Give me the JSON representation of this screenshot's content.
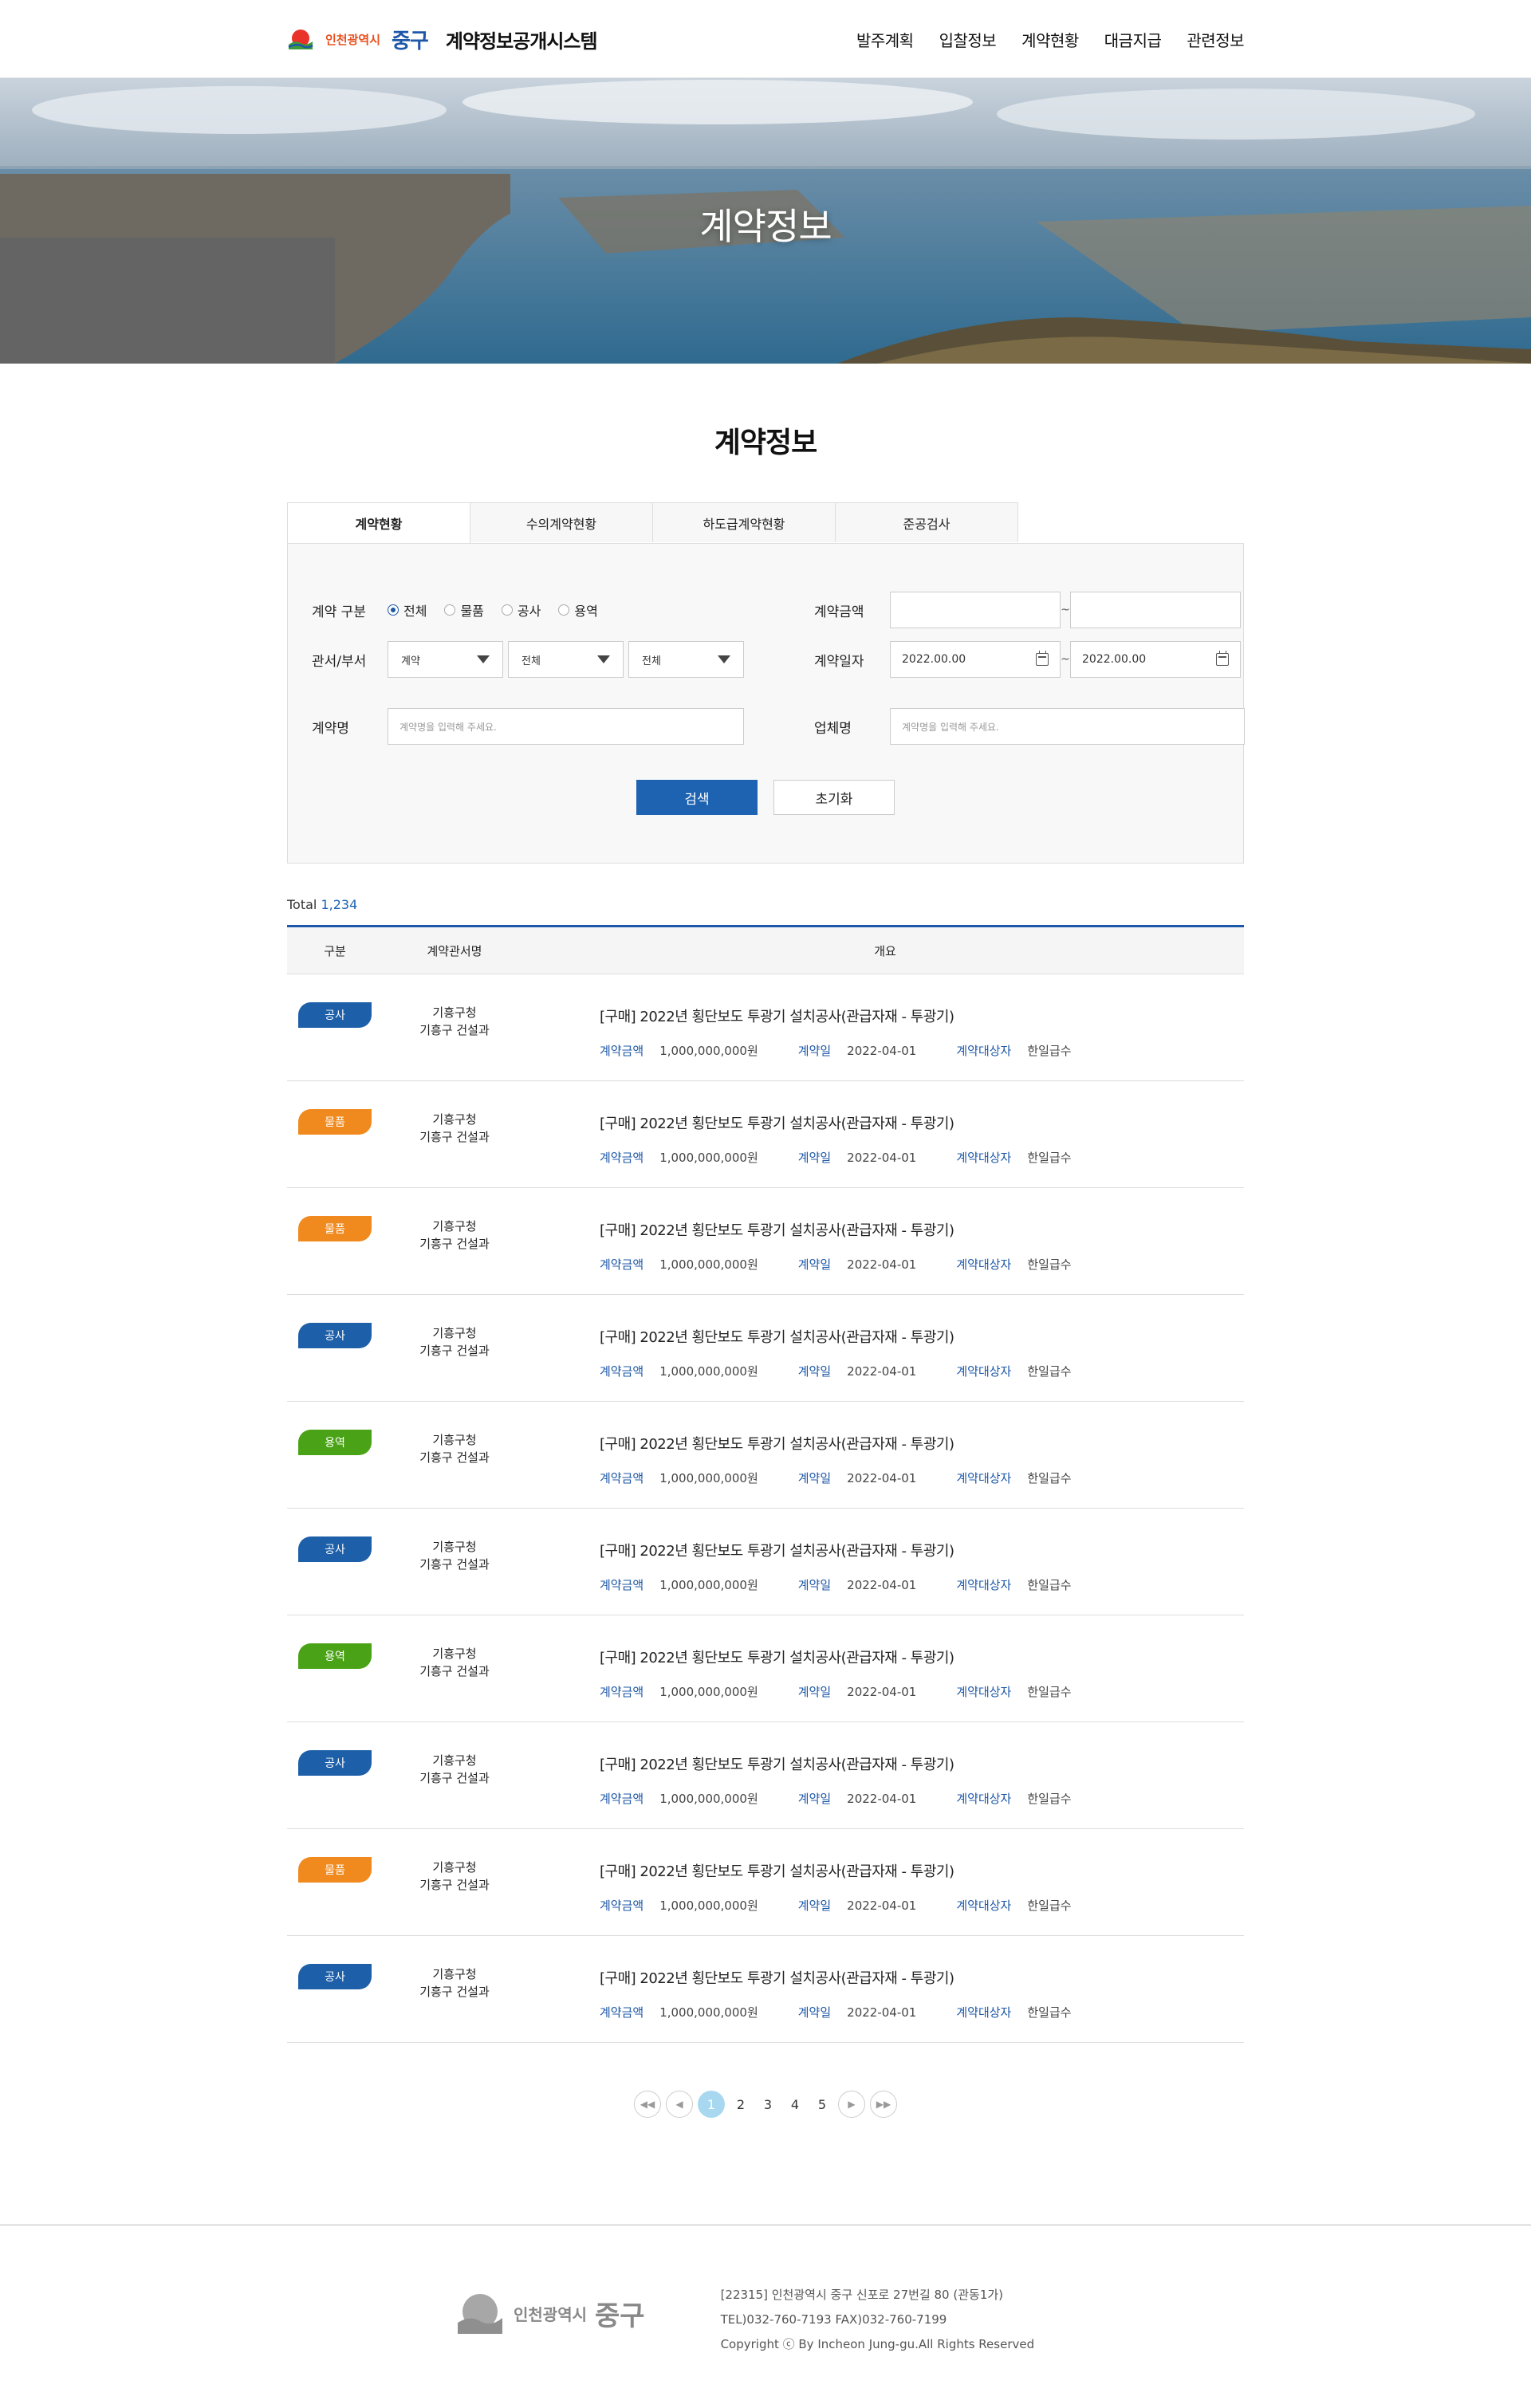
{
  "header": {
    "logo_small": "인천광역시",
    "logo_big": "중구",
    "site_title": "계약정보공개시스템",
    "nav": [
      "발주계획",
      "입찰정보",
      "계약현황",
      "대금지급",
      "관련정보"
    ]
  },
  "banner": {
    "title": "계약정보"
  },
  "page": {
    "heading": "계약정보"
  },
  "tabs": [
    "계약현황",
    "수의계약현황",
    "하도급계약현황",
    "준공검사"
  ],
  "search": {
    "type_label": "계약 구분",
    "type_options": [
      "전체",
      "물품",
      "공사",
      "용역"
    ],
    "type_selected": "전체",
    "amount_label": "계약금액",
    "dept_label": "관서/부서",
    "dept_selects": [
      "계약",
      "전체",
      "전체"
    ],
    "date_label": "계약일자",
    "date_from": "2022.00.00",
    "date_to": "2022.00.00",
    "tilde": "~",
    "name_label": "계약명",
    "name_placeholder": "계약명을 입력해 주세요.",
    "company_label": "업체명",
    "company_placeholder": "계약명을 입력해 주세요.",
    "search_button": "검색",
    "reset_button": "초기화"
  },
  "total": {
    "label": "Total",
    "count": "1,234"
  },
  "list_header": {
    "type": "구분",
    "dept": "계약관서명",
    "summary": "개요"
  },
  "meta_labels": {
    "amount": "계약금액",
    "date": "계약일",
    "vendor": "계약대상자"
  },
  "colors": {
    "공사": "#1d5fa8",
    "물품": "#f08a1e",
    "용역": "#4aa316",
    "accent": "#1d57a7"
  },
  "rows": [
    {
      "type": "공사",
      "dept1": "기흥구청",
      "dept2": "기흥구 건설과",
      "title": "[구매]   2022년 횡단보도 투광기 설치공사(관급자재 - 투광기)",
      "amount": "1,000,000,000원",
      "date": "2022-04-01",
      "vendor": "한일급수"
    },
    {
      "type": "물품",
      "dept1": "기흥구청",
      "dept2": "기흥구 건설과",
      "title": "[구매]   2022년 횡단보도 투광기 설치공사(관급자재 - 투광기)",
      "amount": "1,000,000,000원",
      "date": "2022-04-01",
      "vendor": "한일급수"
    },
    {
      "type": "물품",
      "dept1": "기흥구청",
      "dept2": "기흥구 건설과",
      "title": "[구매]   2022년 횡단보도 투광기 설치공사(관급자재 - 투광기)",
      "amount": "1,000,000,000원",
      "date": "2022-04-01",
      "vendor": "한일급수"
    },
    {
      "type": "공사",
      "dept1": "기흥구청",
      "dept2": "기흥구 건설과",
      "title": "[구매]   2022년 횡단보도 투광기 설치공사(관급자재 - 투광기)",
      "amount": "1,000,000,000원",
      "date": "2022-04-01",
      "vendor": "한일급수"
    },
    {
      "type": "용역",
      "dept1": "기흥구청",
      "dept2": "기흥구 건설과",
      "title": "[구매]   2022년 횡단보도 투광기 설치공사(관급자재 - 투광기)",
      "amount": "1,000,000,000원",
      "date": "2022-04-01",
      "vendor": "한일급수"
    },
    {
      "type": "공사",
      "dept1": "기흥구청",
      "dept2": "기흥구 건설과",
      "title": "[구매]   2022년 횡단보도 투광기 설치공사(관급자재 - 투광기)",
      "amount": "1,000,000,000원",
      "date": "2022-04-01",
      "vendor": "한일급수"
    },
    {
      "type": "용역",
      "dept1": "기흥구청",
      "dept2": "기흥구 건설과",
      "title": "[구매]   2022년 횡단보도 투광기 설치공사(관급자재 - 투광기)",
      "amount": "1,000,000,000원",
      "date": "2022-04-01",
      "vendor": "한일급수"
    },
    {
      "type": "공사",
      "dept1": "기흥구청",
      "dept2": "기흥구 건설과",
      "title": "[구매]   2022년 횡단보도 투광기 설치공사(관급자재 - 투광기)",
      "amount": "1,000,000,000원",
      "date": "2022-04-01",
      "vendor": "한일급수"
    },
    {
      "type": "물품",
      "dept1": "기흥구청",
      "dept2": "기흥구 건설과",
      "title": "[구매]   2022년 횡단보도 투광기 설치공사(관급자재 - 투광기)",
      "amount": "1,000,000,000원",
      "date": "2022-04-01",
      "vendor": "한일급수"
    },
    {
      "type": "공사",
      "dept1": "기흥구청",
      "dept2": "기흥구 건설과",
      "title": "[구매]   2022년 횡단보도 투광기 설치공사(관급자재 - 투광기)",
      "amount": "1,000,000,000원",
      "date": "2022-04-01",
      "vendor": "한일급수"
    }
  ],
  "pagination": {
    "pages": [
      "1",
      "2",
      "3",
      "4",
      "5"
    ],
    "current": "1"
  },
  "footer": {
    "logo_small": "인천광역시",
    "logo_big": "중구",
    "address": "[22315] 인천광역시 중구 신포로 27번길 80 (관동1가)",
    "contact": "TEL)032-760-7193 FAX)032-760-7199",
    "copyright": "Copyright ⓒ By Incheon Jung-gu.All Rights Reserved"
  }
}
